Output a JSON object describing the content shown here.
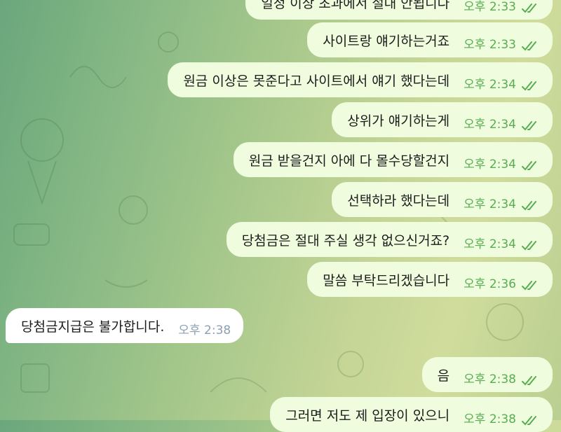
{
  "messages": [
    {
      "text": "일정 이상 초과에서 절대 안됩니다",
      "time": "오후 2:33",
      "dir": "out"
    },
    {
      "text": "사이트랑 얘기하는거죠",
      "time": "오후 2:33",
      "dir": "out"
    },
    {
      "text": "원금 이상은 못준다고 사이트에서 얘기 했다는데",
      "time": "오후 2:34",
      "dir": "out"
    },
    {
      "text": "상위가 얘기하는게",
      "time": "오후 2:34",
      "dir": "out"
    },
    {
      "text": "원금 받을건지 아에 다 몰수당할건지",
      "time": "오후 2:34",
      "dir": "out"
    },
    {
      "text": "선택하라 했다는데",
      "time": "오후 2:34",
      "dir": "out"
    },
    {
      "text": "당첨금은 절대 주실 생각 없으신거죠?",
      "time": "오후 2:34",
      "dir": "out"
    },
    {
      "text": "말씀 부탁드리겠습니다",
      "time": "오후 2:36",
      "dir": "out"
    },
    {
      "text": "당첨금지급은 불가합니다.",
      "time": "오후 2:38",
      "dir": "in"
    },
    {
      "text": "음",
      "time": "오후 2:38",
      "dir": "out"
    },
    {
      "text": "그러면 저도 제 입장이 있으니",
      "time": "오후 2:38",
      "dir": "out"
    }
  ],
  "colors": {
    "outgoing_bubble": "#effdde",
    "incoming_bubble": "#ffffff",
    "out_time": "#58ad52",
    "in_time": "#8da0b3"
  },
  "icons": {
    "read_status": "double-check-icon"
  }
}
